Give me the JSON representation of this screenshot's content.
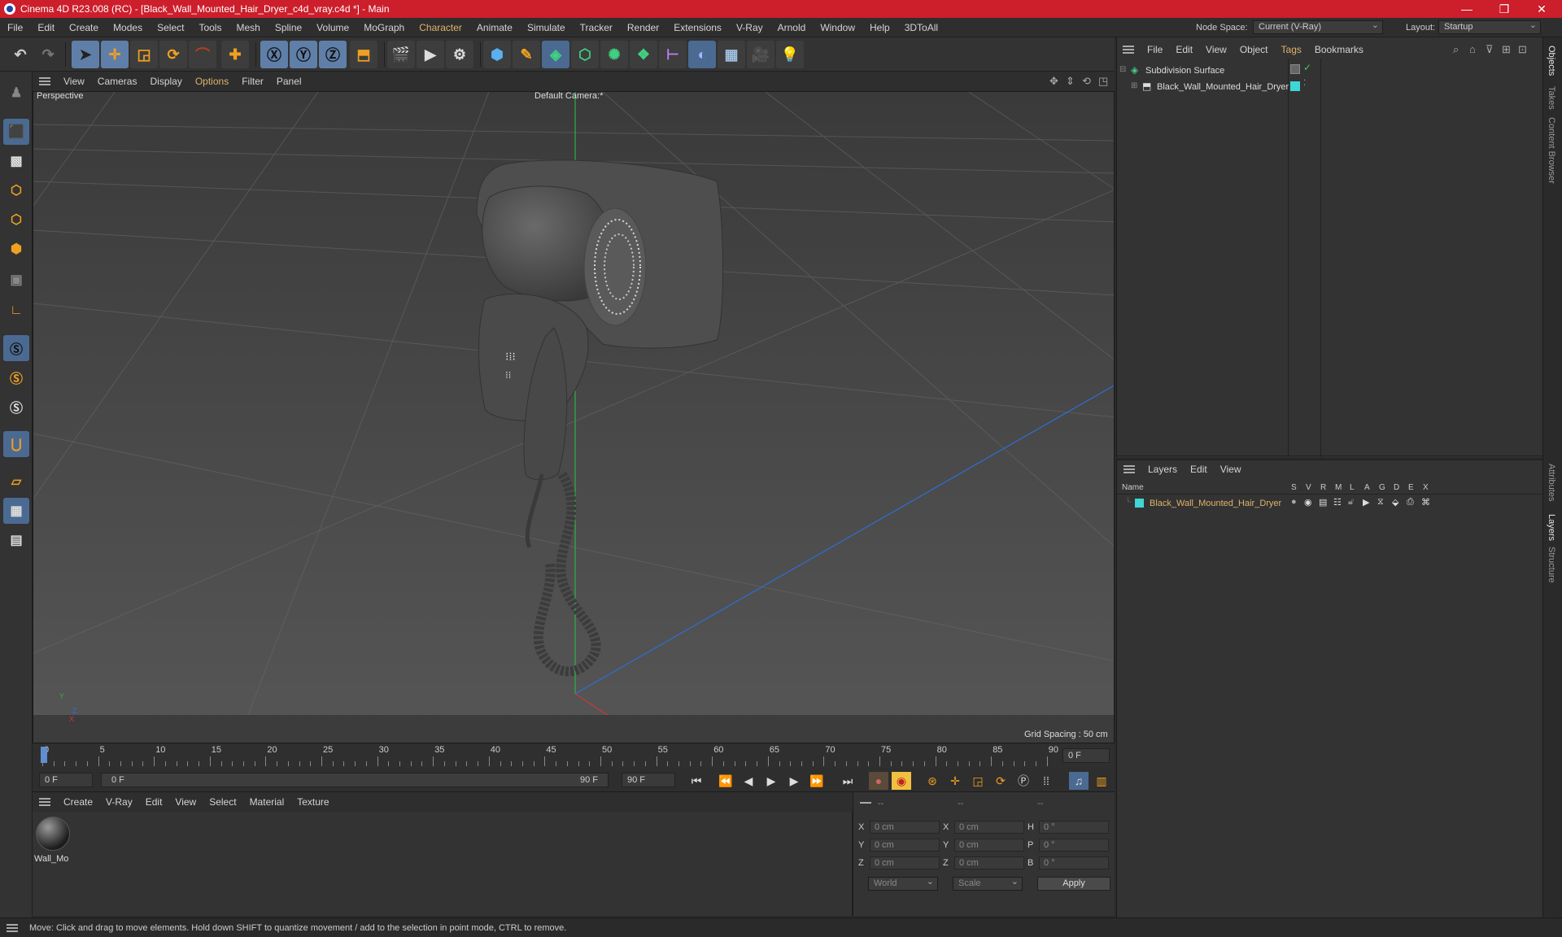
{
  "window": {
    "title": "Cinema 4D R23.008 (RC) - [Black_Wall_Mounted_Hair_Dryer_c4d_vray.c4d *] - Main",
    "minimize": "—",
    "restore": "❐",
    "close": "✕"
  },
  "menubar": {
    "items": [
      "File",
      "Edit",
      "Create",
      "Modes",
      "Select",
      "Tools",
      "Mesh",
      "Spline",
      "Volume",
      "MoGraph",
      "Character",
      "Animate",
      "Simulate",
      "Tracker",
      "Render",
      "Extensions",
      "V-Ray",
      "Arnold",
      "Window",
      "Help",
      "3DToAll"
    ],
    "highlight": [
      "Character"
    ],
    "node_space_label": "Node Space:",
    "node_space_value": "Current (V-Ray)",
    "layout_label": "Layout:",
    "layout_value": "Startup"
  },
  "viewport": {
    "menu": [
      "View",
      "Cameras",
      "Display",
      "Options",
      "Filter",
      "Panel"
    ],
    "menu_highlight": "Options",
    "view_name": "Perspective",
    "camera": "Default Camera",
    "camera_suffix": ":*",
    "grid_spacing": "Grid Spacing : 50 cm",
    "axis_y": "Y",
    "axis_z": "Z",
    "axis_x": "X"
  },
  "timeline": {
    "ticks": [
      "0",
      "5",
      "10",
      "15",
      "20",
      "25",
      "30",
      "35",
      "40",
      "45",
      "50",
      "55",
      "60",
      "65",
      "70",
      "75",
      "80",
      "85",
      "90"
    ],
    "current_frame": "0 F",
    "start_field": "0 F",
    "range_start": "0 F",
    "range_end": "90 F",
    "end_field": "90 F"
  },
  "material_manager": {
    "menu": [
      "Create",
      "V-Ray",
      "Edit",
      "View",
      "Select",
      "Material",
      "Texture"
    ],
    "material_name": "Wall_Mo"
  },
  "coordinates": {
    "header_a": "--",
    "header_b": "--",
    "header_c": "--",
    "rows": [
      {
        "l1": "X",
        "v1": "0 cm",
        "l2": "X",
        "v2": "0 cm",
        "l3": "H",
        "v3": "0 °"
      },
      {
        "l1": "Y",
        "v1": "0 cm",
        "l2": "Y",
        "v2": "0 cm",
        "l3": "P",
        "v3": "0 °"
      },
      {
        "l1": "Z",
        "v1": "0 cm",
        "l2": "Z",
        "v2": "0 cm",
        "l3": "B",
        "v3": "0 °"
      }
    ],
    "space": "World",
    "mode": "Scale",
    "apply": "Apply"
  },
  "object_manager": {
    "menu": [
      "File",
      "Edit",
      "View",
      "Object",
      "Tags",
      "Bookmarks"
    ],
    "menu_highlight": "Tags",
    "objects": [
      {
        "name": "Subdivision Surface"
      },
      {
        "name": "Black_Wall_Mounted_Hair_Dryer"
      }
    ]
  },
  "layer_manager": {
    "menu": [
      "Layers",
      "Edit",
      "View"
    ],
    "columns": [
      "Name",
      "S",
      "V",
      "R",
      "M",
      "L",
      "A",
      "G",
      "D",
      "E",
      "X"
    ],
    "layers": [
      {
        "name": "Black_Wall_Mounted_Hair_Dryer",
        "color": "#3fd6d6"
      }
    ]
  },
  "side_tabs": [
    "Objects",
    "Takes",
    "Content Browser",
    "Attributes",
    "Layers",
    "Structure"
  ],
  "status": "Move: Click and drag to move elements. Hold down SHIFT to quantize movement / add to the selection in point mode, CTRL to remove.",
  "colors": {
    "titlebar": "#cc1e2b",
    "accent": "#e0b26a",
    "layer": "#3fd6d6",
    "axis_green": "#2fae4a",
    "axis_blue": "#2c6fd8",
    "axis_red": "#c83838"
  }
}
